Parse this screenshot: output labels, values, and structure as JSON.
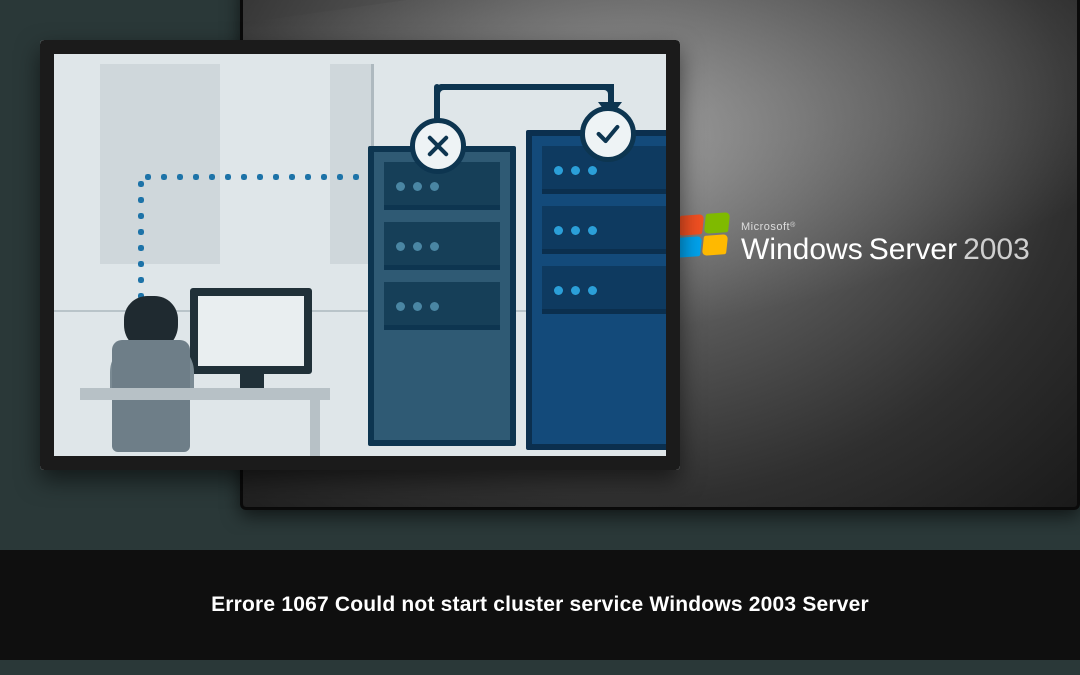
{
  "brand": {
    "company": "Microsoft",
    "trademark": "®",
    "product_a": "Windows",
    "product_b": "Server",
    "year": "2003"
  },
  "caption": {
    "title": "Errore 1067 Could not start cluster service Windows 2003 Server"
  },
  "illustration": {
    "failed_icon": "x",
    "ok_icon": "check"
  }
}
